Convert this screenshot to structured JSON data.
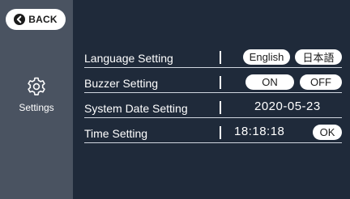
{
  "sidebar": {
    "back_label": "BACK",
    "items": [
      {
        "label": "Settings",
        "icon": "gear-icon"
      }
    ]
  },
  "settings": {
    "language": {
      "label": "Language Setting",
      "options": [
        "English",
        "日本語"
      ]
    },
    "buzzer": {
      "label": "Buzzer Setting",
      "options": [
        "ON",
        "OFF"
      ]
    },
    "date": {
      "label": "System Date Setting",
      "value": "2020-05-23"
    },
    "time": {
      "label": "Time Setting",
      "value": "18:18:18",
      "ok_label": "OK"
    }
  },
  "colors": {
    "background": "#1f2a3a",
    "sidebar": "#4a5361",
    "text": "#ffffff"
  }
}
